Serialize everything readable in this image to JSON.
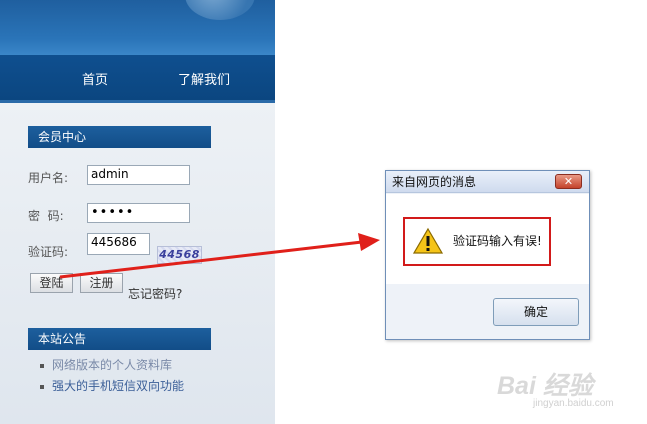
{
  "nav": {
    "home": "首页",
    "about": "了解我们"
  },
  "member": {
    "title": "会员中心",
    "user_label": "用户名:",
    "user_value": "admin",
    "pass_label": "密  码:",
    "pass_value": "•••••",
    "code_label": "验证码:",
    "code_value": "445686",
    "captcha": "44568",
    "login": "登陆",
    "register": "注册",
    "forgot": "忘记密码?"
  },
  "notice": {
    "title": "本站公告",
    "items": [
      "网络版本的个人资料库",
      "强大的手机短信双向功能"
    ]
  },
  "dialog": {
    "title": "来自网页的消息",
    "close": "✕",
    "message": "验证码输入有误!",
    "ok": "确定"
  },
  "watermark": {
    "brand": "Bai 经验",
    "url": "jingyan.baidu.com"
  },
  "colors": {
    "accent": "#124d88",
    "alert": "#d21a1a"
  }
}
